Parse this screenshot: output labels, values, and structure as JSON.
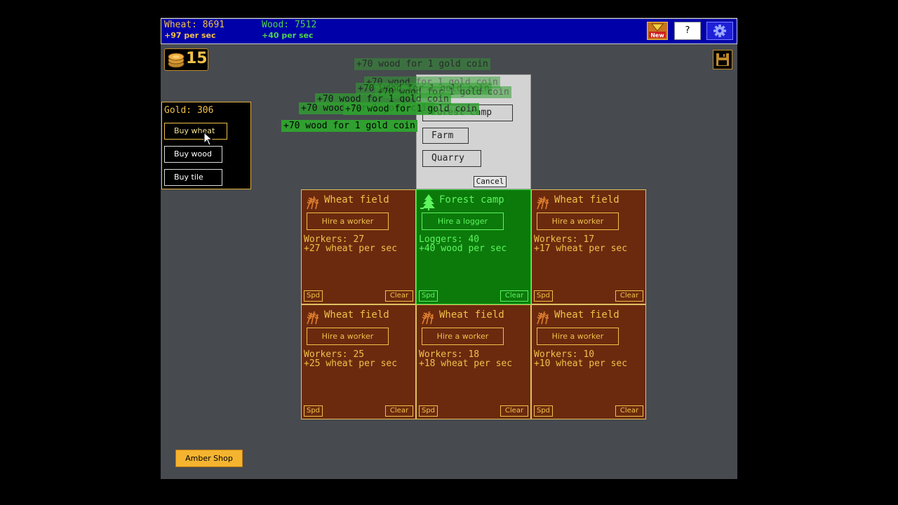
{
  "topbar": {
    "wheat_label": "Wheat: 8691",
    "wheat_rate": "+97 per sec",
    "wood_label": "Wood: 7512",
    "wood_rate": "+40 per sec",
    "new_badge": "New",
    "help_label": "?",
    "settings_icon": "gear-icon"
  },
  "coins": {
    "count": "15",
    "icon": "coin-stack-icon"
  },
  "gold_panel": {
    "gold_label": "Gold: 306",
    "buy_wheat": "Buy wheat",
    "buy_wood": "Buy wood",
    "buy_tile": "Buy tile"
  },
  "dialog": {
    "hidden_option": "Forest camp",
    "farm": "Farm",
    "quarry": "Quarry",
    "cancel": "Cancel"
  },
  "notifications": {
    "text": "+70 wood for 1 gold coin",
    "count": 8
  },
  "tiles": [
    {
      "type": "wheat",
      "title": "Wheat field",
      "hire": "Hire a worker",
      "workers": "Workers: 27",
      "rate": "+27 wheat per sec",
      "spd": "Spd",
      "clear": "Clear"
    },
    {
      "type": "forest",
      "title": "Forest camp",
      "hire": "Hire a logger",
      "workers": "Loggers: 40",
      "rate": "+40 wood per sec",
      "spd": "Spd",
      "clear": "Clear"
    },
    {
      "type": "wheat",
      "title": "Wheat field",
      "hire": "Hire a worker",
      "workers": "Workers: 17",
      "rate": "+17 wheat per sec",
      "spd": "Spd",
      "clear": "Clear"
    },
    {
      "type": "wheat",
      "title": "Wheat field",
      "hire": "Hire a worker",
      "workers": "Workers: 25",
      "rate": "+25 wheat per sec",
      "spd": "Spd",
      "clear": "Clear"
    },
    {
      "type": "wheat",
      "title": "Wheat field",
      "hire": "Hire a worker",
      "workers": "Workers: 18",
      "rate": "+18 wheat per sec",
      "spd": "Spd",
      "clear": "Clear"
    },
    {
      "type": "wheat",
      "title": "Wheat field",
      "hire": "Hire a worker",
      "workers": "Workers: 10",
      "rate": "+10 wheat per sec",
      "spd": "Spd",
      "clear": "Clear"
    }
  ],
  "amber_shop": "Amber Shop",
  "colors": {
    "wheat": "#f0c04a",
    "wood": "#4ed34e",
    "wheat_tile_bg": "#6b2a0e",
    "forest_tile_bg": "#0b7a0b",
    "topbar_bg": "#0000a8",
    "amber": "#f5b430"
  }
}
